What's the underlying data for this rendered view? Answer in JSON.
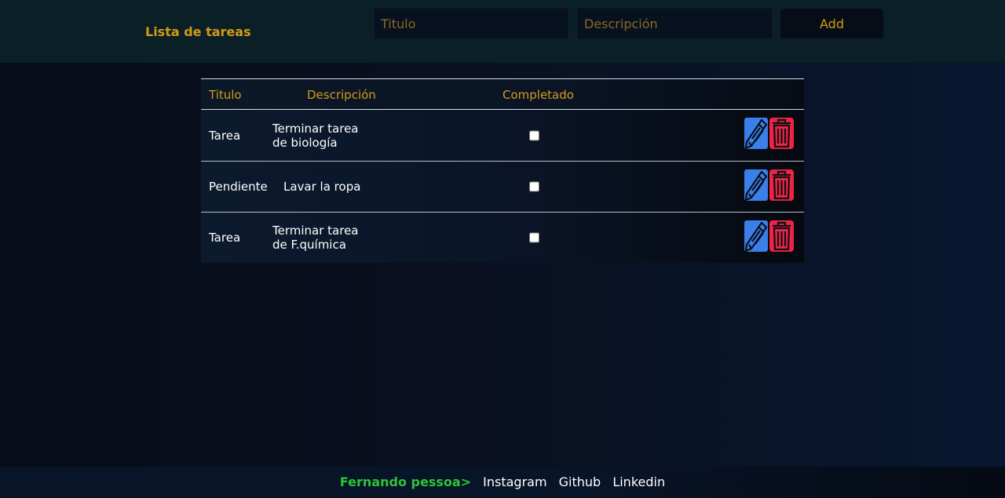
{
  "header": {
    "title": "Lista de tareas",
    "title_placeholder": "Titulo",
    "description_placeholder": "Descripción",
    "add_label": "Add"
  },
  "table": {
    "columns": {
      "title": "Titulo",
      "description": "Descripción",
      "completed": "Completado"
    },
    "rows": [
      {
        "title": "Tarea",
        "description_lines": [
          "Terminar tarea",
          "de biología"
        ],
        "completed": false
      },
      {
        "title": "Pendiente",
        "description_lines": [
          "Lavar la ropa"
        ],
        "completed": false
      },
      {
        "title": "Tarea",
        "description_lines": [
          "Terminar tarea",
          "de F.química"
        ],
        "completed": false
      }
    ],
    "edit_icon": "pencil-icon",
    "delete_icon": "trash-icon"
  },
  "footer": {
    "author": "Fernando pessoa>",
    "links": [
      "Instagram",
      "Github",
      "Linkedin"
    ]
  },
  "colors": {
    "accent": "#d49a17",
    "edit": "#3a80ea",
    "delete": "#ee2443",
    "author": "#2ec438"
  }
}
